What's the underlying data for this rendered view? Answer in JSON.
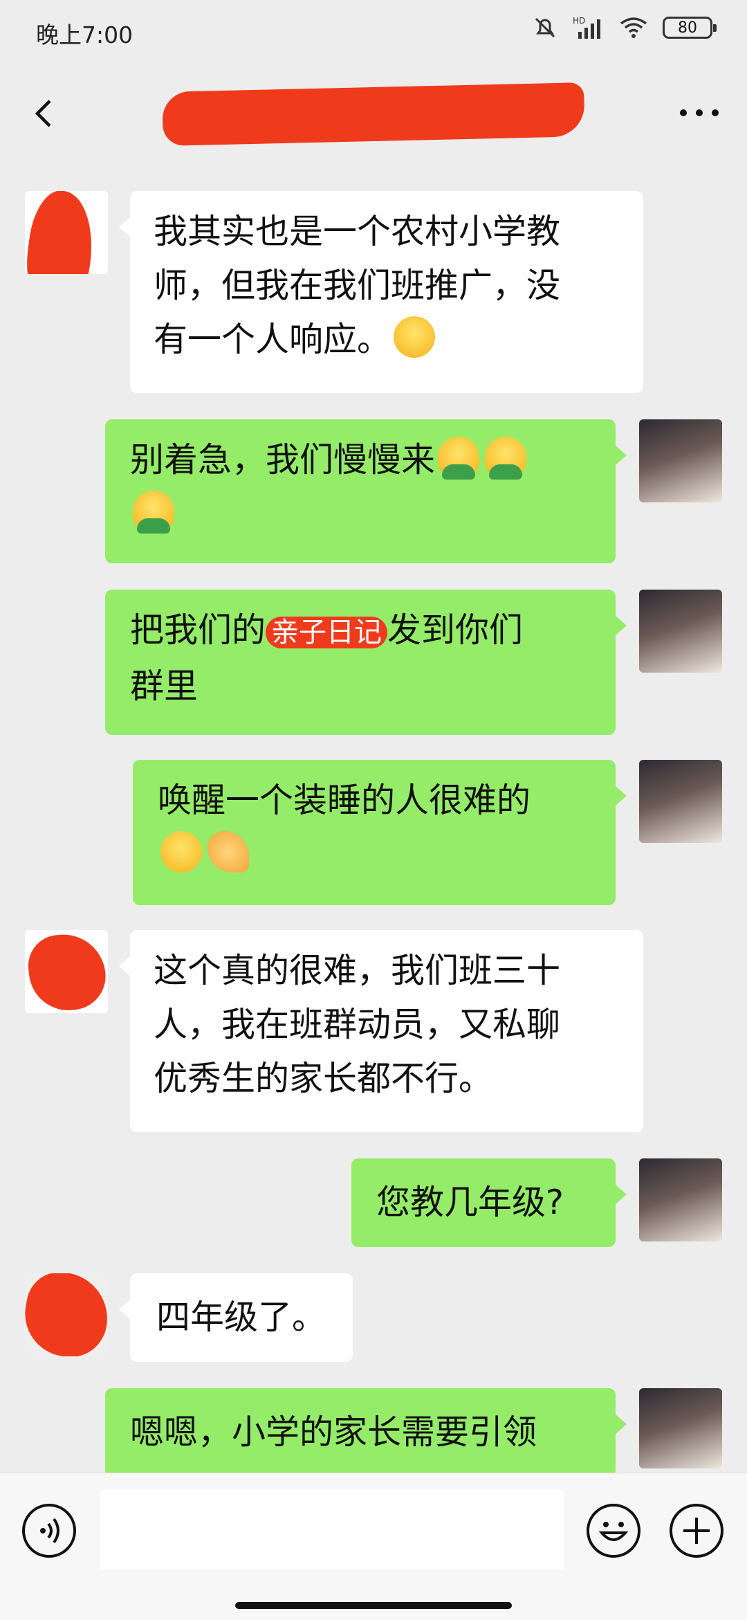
{
  "status_bar": {
    "time": "晚上7:00",
    "network_label": "HD",
    "battery": "80"
  },
  "nav": {
    "title": "",
    "back_icon": "chevron-left-icon",
    "more_icon": "more-icon"
  },
  "messages": [
    {
      "side": "in",
      "text": [
        "我其实也是一个农村小学教",
        "师，但我在我们班推广，没",
        "有一个人响应。"
      ],
      "emoji_tail": "laugh-cry"
    },
    {
      "side": "out",
      "text": [
        "别着急，我们慢慢来"
      ],
      "emoji_tail": "3x-person-emoji"
    },
    {
      "side": "out",
      "text": [
        "把我们的",
        "亲子日记",
        "发到你们",
        "群里"
      ]
    },
    {
      "side": "out",
      "text": [
        "唤醒一个装睡的人很难的"
      ],
      "emoji_tail": "wink-tongue,ok-hand"
    },
    {
      "side": "in",
      "text": [
        "这个真的很难，我们班三十",
        "人，我在班群动员，又私聊",
        "优秀生的家长都不行。"
      ]
    },
    {
      "side": "out",
      "text": [
        "您教几年级?"
      ]
    },
    {
      "side": "in",
      "text": [
        "四年级了。"
      ]
    },
    {
      "side": "out",
      "text": [
        "嗯嗯，小学的家长需要引领"
      ]
    }
  ],
  "bottom_bar": {
    "voice_icon": "voice-icon",
    "emoji_icon": "emoji-icon",
    "plus_icon": "plus-icon"
  },
  "colors": {
    "background": "#ededed",
    "outgoing_bubble": "#95ec69",
    "incoming_bubble": "#ffffff",
    "redaction": "#f03a1c"
  }
}
